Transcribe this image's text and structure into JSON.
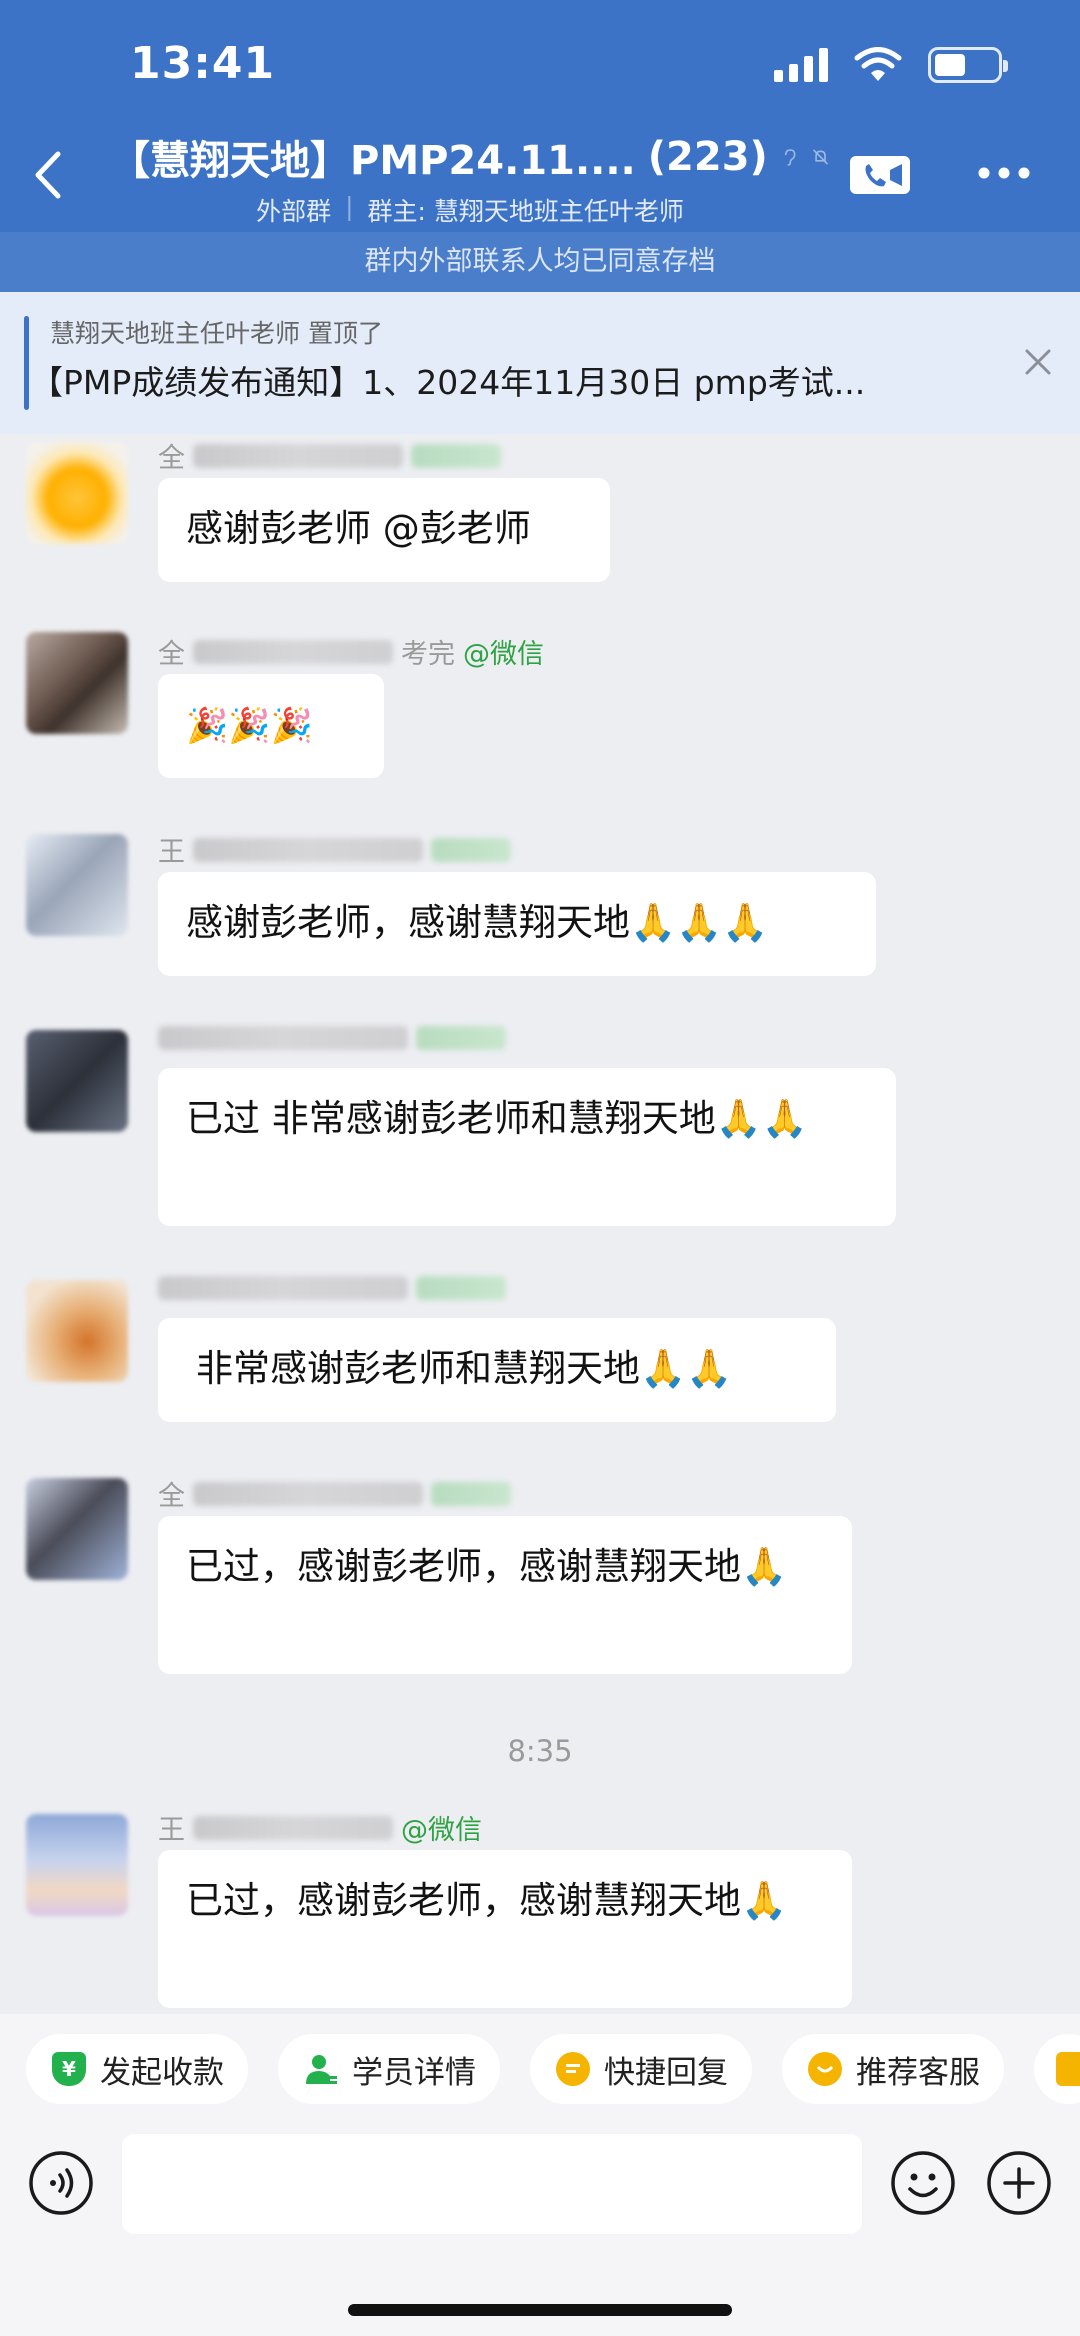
{
  "status_bar": {
    "time": "13:41"
  },
  "header": {
    "title": "【慧翔天地】PMP24.11....",
    "member_count": "(223)",
    "group_type": "外部群",
    "owner": "群主: 慧翔天地班主任叶老师"
  },
  "archive_notice": "群内外部联系人均已同意存档",
  "pinned": {
    "pinned_by": "慧翔天地班主任叶老师 置顶了",
    "text": "【PMP成绩发布通知】1、2024年11月30日 pmp考试..."
  },
  "messages": [
    {
      "sender_prefix": "全",
      "tag": "",
      "tag_suffix": "",
      "text": "感谢彭老师 @彭老师"
    },
    {
      "sender_prefix": "全",
      "tag": "@微信",
      "tag_suffix": "考完",
      "text": "🎉🎉🎉"
    },
    {
      "sender_prefix": "王",
      "tag": "",
      "tag_suffix": "",
      "text": "感谢彭老师，感谢慧翔天地🙏🙏🙏"
    },
    {
      "sender_prefix": "",
      "tag": "",
      "tag_suffix": "",
      "text": "已过 非常感谢彭老师和慧翔天地🙏🙏"
    },
    {
      "sender_prefix": "",
      "tag": "",
      "tag_suffix": "",
      "text": "非常感谢彭老师和慧翔天地🙏🙏"
    },
    {
      "sender_prefix": "全",
      "tag": "",
      "tag_suffix": "",
      "text": "已过，感谢彭老师，感谢慧翔天地🙏"
    },
    {
      "sender_prefix": "王",
      "tag": "@微信",
      "tag_suffix": "",
      "text": "已过，感谢彭老师，感谢慧翔天地🙏"
    }
  ],
  "time_separator": "8:35",
  "quick_actions": [
    {
      "label": "发起收款",
      "icon": "yuan-shield-icon",
      "color": "#22b14c"
    },
    {
      "label": "学员详情",
      "icon": "user-card-icon",
      "color": "#22b14c"
    },
    {
      "label": "快捷回复",
      "icon": "quick-reply-icon",
      "color": "#f5b400"
    },
    {
      "label": "推荐客服",
      "icon": "recommend-service-icon",
      "color": "#f5b400"
    }
  ],
  "colors": {
    "header_bg": "#3c73c6",
    "archive_bg": "#4a7ecb",
    "pinned_bg": "#e3ecf8",
    "chat_bg": "#edeef2",
    "wechat_green": "#2fa344"
  }
}
